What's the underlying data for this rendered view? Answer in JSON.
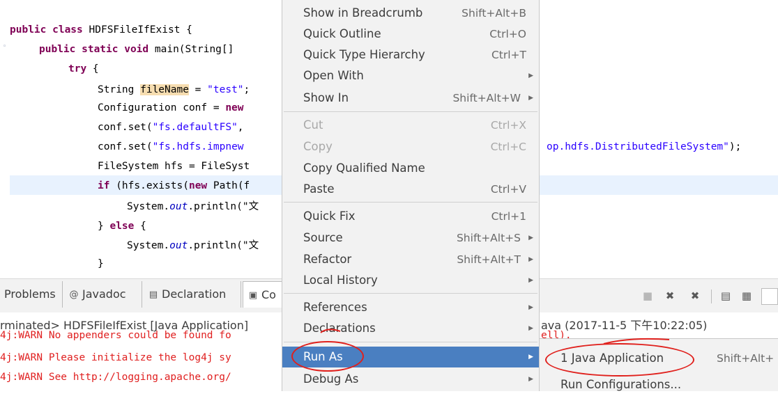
{
  "code": {
    "line1": {
      "kw": "public class ",
      "rest": "HDFSFileIfExist {"
    },
    "line2": {
      "kw": "public static void ",
      "rest": "main(String[]"
    },
    "line3": {
      "kw": "try",
      "rest": " {"
    },
    "line4": {
      "pre": "String ",
      "hl": "fileName",
      "mid": " = ",
      "str": "\"test\"",
      "post": ";"
    },
    "line5": {
      "pre": "Configuration conf = ",
      "kw": "new"
    },
    "line6": {
      "pre": "conf.set(",
      "str": "\"fs.defaultFS\"",
      "post": ","
    },
    "line7": {
      "pre": "conf.set(",
      "str": "\"fs.hdfs.impnew",
      "tail": "op.hdfs.DistributedFileSystem\"",
      "tail2": ");"
    },
    "line8": {
      "pre": "FileSystem hfs = FileSyst"
    },
    "line9": {
      "kw": "if",
      "pre": " (hfs.exists(",
      "kw2": "new",
      "post": " Path(f"
    },
    "line10": {
      "pre": "System.",
      "fld": "out",
      "post": ".println(\"文"
    },
    "line11": {
      "pre": "} ",
      "kw": "else",
      "post": " {"
    },
    "line12": {
      "pre": "System.",
      "fld": "out",
      "post": ".println(\"文"
    },
    "line13": {
      "pre": "}"
    }
  },
  "tabs": [
    {
      "label": "Problems",
      "icon": "problems-icon"
    },
    {
      "label": "Javadoc",
      "icon": "at-icon",
      "glyph": "@"
    },
    {
      "label": "Declaration",
      "icon": "declaration-icon"
    },
    {
      "label": "Co",
      "icon": "console-icon"
    }
  ],
  "console": {
    "header_left": "rminated> HDFSFileIfExist [Java Application]",
    "header_right": "ava (2017-11-5 下午10:22:05)",
    "line1_left": "4j:WARN No appenders could be found fo",
    "line1_right": "ell).",
    "line2": "4j:WARN Please initialize the log4j sy",
    "line3": "4j:WARN See http://logging.apache.org/"
  },
  "menu": {
    "items": [
      {
        "label": "Show in Breadcrumb",
        "shortcut": "Shift+Alt+B"
      },
      {
        "label": "Quick Outline",
        "shortcut": "Ctrl+O"
      },
      {
        "label": "Quick Type Hierarchy",
        "shortcut": "Ctrl+T"
      },
      {
        "label": "Open With",
        "shortcut": ""
      },
      {
        "label": "Show In",
        "shortcut": "Shift+Alt+W"
      },
      {
        "label": "Cut",
        "shortcut": "Ctrl+X"
      },
      {
        "label": "Copy",
        "shortcut": "Ctrl+C"
      },
      {
        "label": "Copy Qualified Name",
        "shortcut": ""
      },
      {
        "label": "Paste",
        "shortcut": "Ctrl+V"
      },
      {
        "label": "Quick Fix",
        "shortcut": "Ctrl+1"
      },
      {
        "label": "Source",
        "shortcut": "Shift+Alt+S"
      },
      {
        "label": "Refactor",
        "shortcut": "Shift+Alt+T"
      },
      {
        "label": "Local History",
        "shortcut": ""
      },
      {
        "label": "References",
        "shortcut": ""
      },
      {
        "label": "Declarations",
        "shortcut": ""
      },
      {
        "label": "Run As",
        "shortcut": ""
      },
      {
        "label": "Debug As",
        "shortcut": ""
      }
    ]
  },
  "submenu": {
    "items": [
      {
        "label": "1 Java Application",
        "shortcut": "Shift+Alt+"
      },
      {
        "label": "Run Configurations...",
        "shortcut": ""
      }
    ]
  },
  "colors": {
    "selection": "#4a7fc1",
    "annotation_circle": "#e0201c",
    "keyword": "#7f0055",
    "string": "#2a00ff",
    "console_error": "#e02020"
  }
}
